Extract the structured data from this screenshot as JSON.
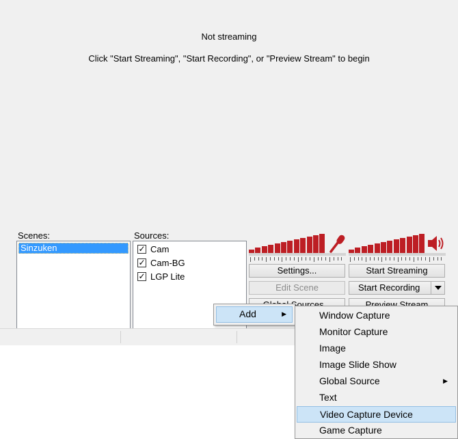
{
  "status": {
    "title": "Not streaming",
    "hint": "Click \"Start Streaming\", \"Start Recording\", or \"Preview Stream\" to begin"
  },
  "scenes": {
    "label": "Scenes:",
    "items": [
      "Sinzuken"
    ]
  },
  "sources": {
    "label": "Sources:",
    "items": [
      {
        "name": "Cam",
        "checked": true
      },
      {
        "name": "Cam-BG",
        "checked": true
      },
      {
        "name": "LGP Lite",
        "checked": true
      }
    ]
  },
  "meters": {
    "mic_icon": "microphone-icon",
    "speaker_icon": "speaker-icon",
    "accent": "#bd1e24"
  },
  "buttons": {
    "settings": "Settings...",
    "start_streaming": "Start Streaming",
    "edit_scene": "Edit Scene",
    "start_recording": "Start Recording",
    "global_sources": "Global Sources...",
    "preview_stream": "Preview Stream"
  },
  "context_menu": {
    "add": "Add",
    "submenu": [
      {
        "label": "Window Capture",
        "has_submenu": false
      },
      {
        "label": "Monitor Capture",
        "has_submenu": false
      },
      {
        "label": "Image",
        "has_submenu": false
      },
      {
        "label": "Image Slide Show",
        "has_submenu": false
      },
      {
        "label": "Global Source",
        "has_submenu": true
      },
      {
        "label": "Text",
        "has_submenu": false
      },
      {
        "label": "Video Capture Device",
        "has_submenu": false,
        "highlighted": true
      },
      {
        "label": "Game Capture",
        "has_submenu": false
      }
    ]
  }
}
